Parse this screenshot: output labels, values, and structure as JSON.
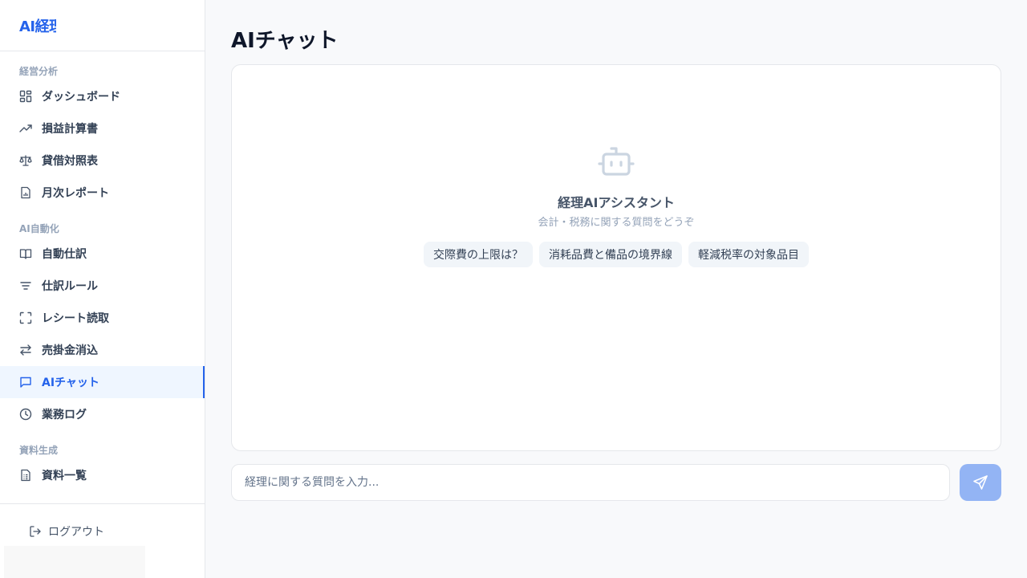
{
  "app": {
    "logo": "AI経理"
  },
  "sidebar": {
    "sections": [
      {
        "label": "経営分析"
      },
      {
        "label": "AI自動化"
      },
      {
        "label": "資料生成"
      }
    ],
    "items": [
      {
        "label": "ダッシュボード",
        "icon": "dashboard-icon"
      },
      {
        "label": "損益計算書",
        "icon": "trending-up-icon"
      },
      {
        "label": "貸借対照表",
        "icon": "scale-icon"
      },
      {
        "label": "月次レポート",
        "icon": "report-icon"
      },
      {
        "label": "自動仕訳",
        "icon": "book-icon"
      },
      {
        "label": "仕訳ルール",
        "icon": "filter-icon"
      },
      {
        "label": "レシート読取",
        "icon": "scan-icon"
      },
      {
        "label": "売掛金消込",
        "icon": "swap-icon"
      },
      {
        "label": "AIチャット",
        "icon": "chat-icon",
        "active": true
      },
      {
        "label": "業務ログ",
        "icon": "clock-icon"
      },
      {
        "label": "資料一覧",
        "icon": "document-list-icon"
      }
    ],
    "logout_label": "ログアウト"
  },
  "main": {
    "title": "AIチャット",
    "assistant": {
      "title": "経理AIアシスタント",
      "subtitle": "会計・税務に関する質問をどうぞ"
    },
    "suggestions": [
      "交際費の上限は？",
      "消耗品費と備品の境界線",
      "軽減税率の対象品目"
    ],
    "input": {
      "placeholder": "経理に関する質問を入力...",
      "value": ""
    }
  },
  "colors": {
    "accent": "#2563eb",
    "active_bg": "#eff6ff",
    "send_button": "#93b4f4",
    "robot_icon": "#cbd5e1"
  }
}
